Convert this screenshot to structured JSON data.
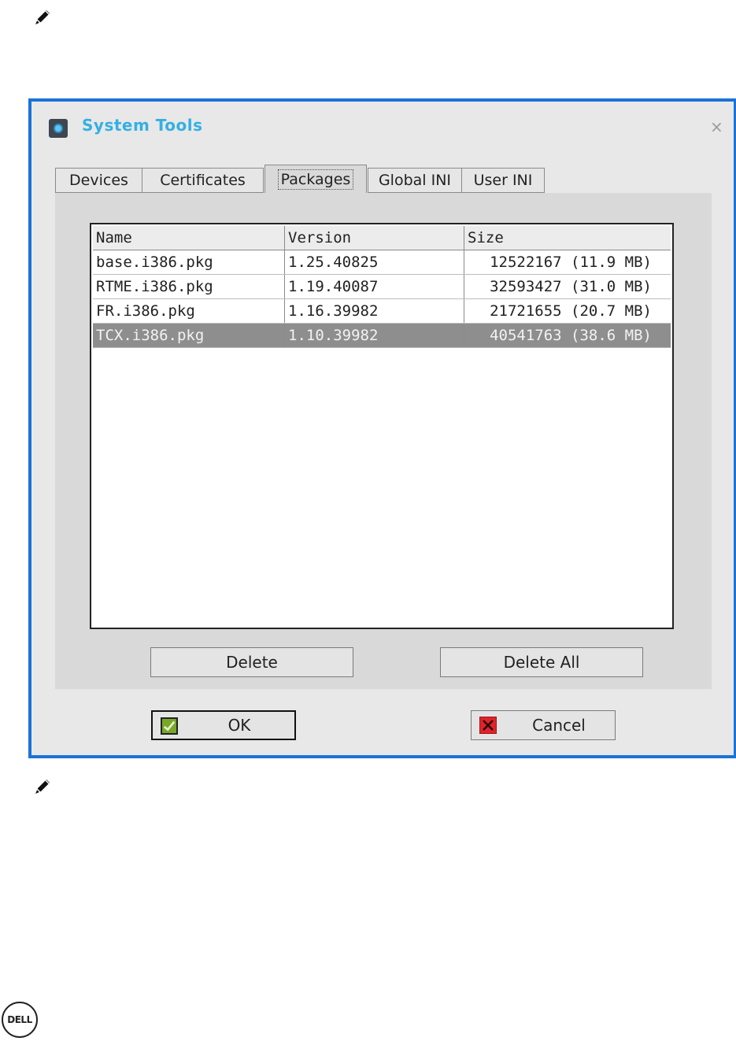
{
  "dialog": {
    "title": "System Tools",
    "close_glyph": "×",
    "app_icon": "system-tools-icon"
  },
  "tabs": [
    {
      "label": "Devices",
      "active": false
    },
    {
      "label": "Certificates",
      "active": false
    },
    {
      "label": "Packages",
      "active": true
    },
    {
      "label": "Global INI",
      "active": false
    },
    {
      "label": "User INI",
      "active": false
    }
  ],
  "packages_table": {
    "columns": [
      "Name",
      "Version",
      "Size"
    ],
    "rows": [
      {
        "name": "base.i386.pkg",
        "version": "1.25.40825",
        "size": "12522167 (11.9 MB)",
        "selected": false
      },
      {
        "name": "RTME.i386.pkg",
        "version": "1.19.40087",
        "size": "32593427 (31.0 MB)",
        "selected": false
      },
      {
        "name": "FR.i386.pkg",
        "version": "1.16.39982",
        "size": "21721655 (20.7 MB)",
        "selected": false
      },
      {
        "name": "TCX.i386.pkg",
        "version": "1.10.39982",
        "size": "40541763 (38.6 MB)",
        "selected": true
      }
    ]
  },
  "actions": {
    "delete_label": "Delete",
    "delete_all_label": "Delete All"
  },
  "footer": {
    "ok_label": "OK",
    "cancel_label": "Cancel"
  },
  "page": {
    "note_icons": [
      "note-pencil-icon",
      "note-pencil-icon"
    ],
    "logo_text": "DELL"
  },
  "colors": {
    "dialog_border": "#1a73d9",
    "title_text": "#33b0e3",
    "selected_row": "#8e8e8e",
    "ok_icon": "#77a82a",
    "cancel_icon": "#e0232a"
  }
}
